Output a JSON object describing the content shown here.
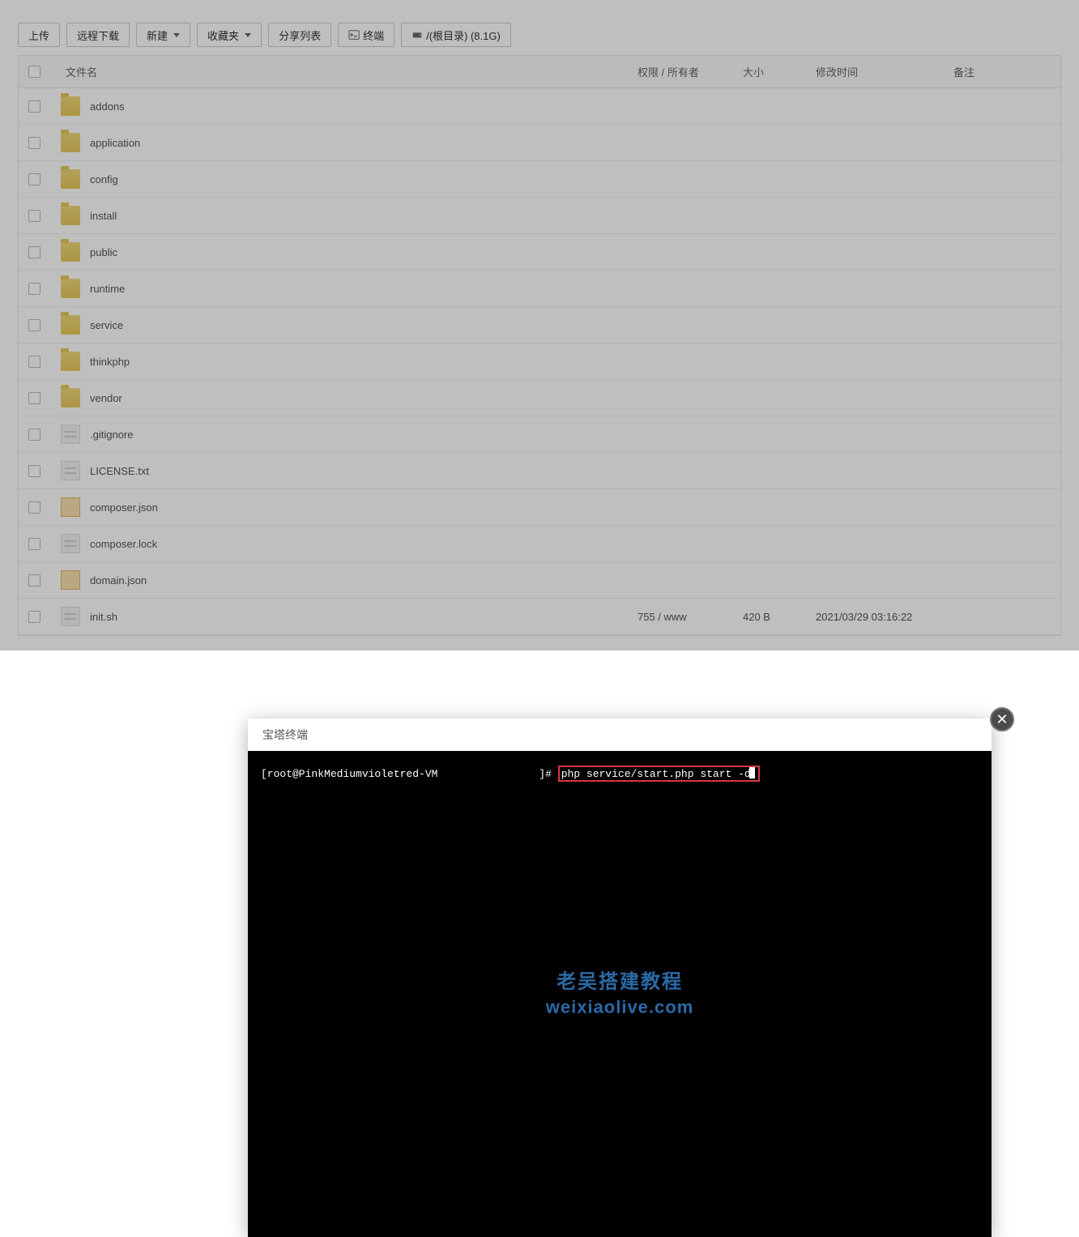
{
  "toolbar": {
    "upload": "上传",
    "remote_download": "远程下载",
    "new": "新建",
    "favorites": "收藏夹",
    "share_list": "分享列表",
    "terminal": "终端",
    "root_path": "/(根目录) (8.1G)"
  },
  "table": {
    "headers": {
      "name": "文件名",
      "perm": "权限 / 所有者",
      "size": "大小",
      "mtime": "修改时间",
      "note": "备注"
    },
    "rows": [
      {
        "name": "addons",
        "type": "folder",
        "perm": "",
        "size": "",
        "mtime": ""
      },
      {
        "name": "application",
        "type": "folder",
        "perm": "",
        "size": "",
        "mtime": ""
      },
      {
        "name": "config",
        "type": "folder",
        "perm": "",
        "size": "",
        "mtime": ""
      },
      {
        "name": "install",
        "type": "folder",
        "perm": "",
        "size": "",
        "mtime": ""
      },
      {
        "name": "public",
        "type": "folder",
        "perm": "",
        "size": "",
        "mtime": ""
      },
      {
        "name": "runtime",
        "type": "folder",
        "perm": "",
        "size": "",
        "mtime": ""
      },
      {
        "name": "service",
        "type": "folder",
        "perm": "",
        "size": "",
        "mtime": ""
      },
      {
        "name": "thinkphp",
        "type": "folder",
        "perm": "",
        "size": "",
        "mtime": ""
      },
      {
        "name": "vendor",
        "type": "folder",
        "perm": "",
        "size": "",
        "mtime": ""
      },
      {
        "name": ".gitignore",
        "type": "txt",
        "perm": "",
        "size": "",
        "mtime": ""
      },
      {
        "name": "LICENSE.txt",
        "type": "txt",
        "perm": "",
        "size": "",
        "mtime": ""
      },
      {
        "name": "composer.json",
        "type": "json",
        "perm": "",
        "size": "",
        "mtime": ""
      },
      {
        "name": "composer.lock",
        "type": "txt",
        "perm": "",
        "size": "",
        "mtime": ""
      },
      {
        "name": "domain.json",
        "type": "json",
        "perm": "",
        "size": "",
        "mtime": ""
      },
      {
        "name": "init.sh",
        "type": "txt",
        "perm": "755 / www",
        "size": "420 B",
        "mtime": "2021/03/29 03:16:22"
      }
    ]
  },
  "modal": {
    "title": "宝塔终端",
    "prompt_left": "[root@PinkMediumvioletred-VM",
    "prompt_right": "]#",
    "command": "php service/start.php start -d"
  },
  "watermark": {
    "line1": "老吴搭建教程",
    "line2": "weixiaolive.com"
  }
}
